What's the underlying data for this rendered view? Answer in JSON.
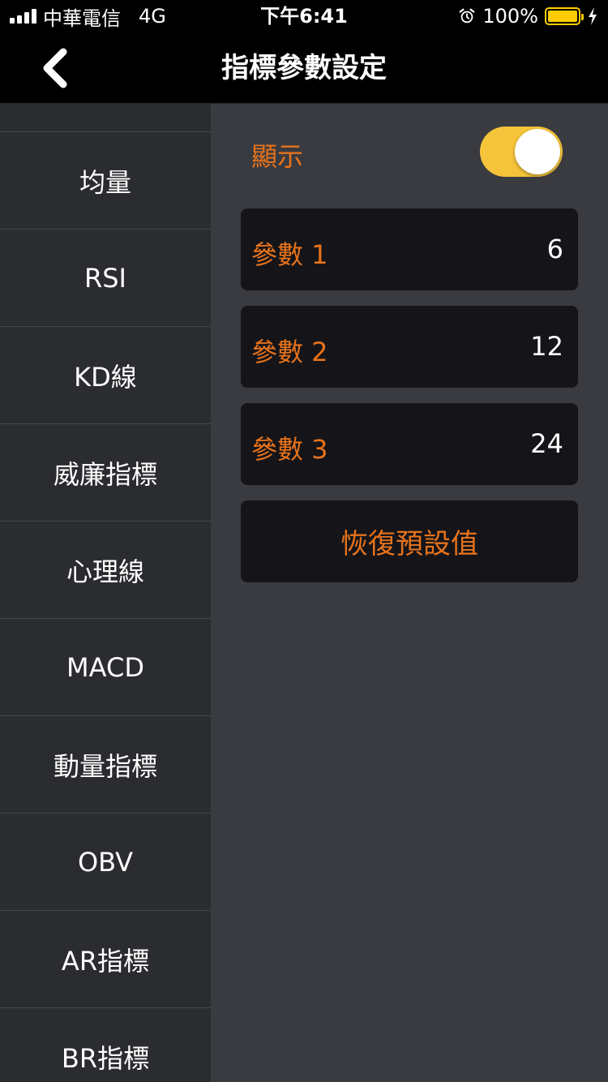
{
  "status_bar": {
    "carrier": "中華電信",
    "network": "4G",
    "time": "下午6:41",
    "battery_percent": "100%",
    "battery_level": 1.0,
    "battery_color": "#ffcc00"
  },
  "nav": {
    "title": "指標參數設定",
    "back_icon": "chevron-left-icon"
  },
  "sidebar": {
    "items": [
      {
        "label": "均量"
      },
      {
        "label": "RSI"
      },
      {
        "label": "KD線"
      },
      {
        "label": "威廉指標"
      },
      {
        "label": "心理線"
      },
      {
        "label": "MACD"
      },
      {
        "label": "動量指標"
      },
      {
        "label": "OBV"
      },
      {
        "label": "AR指標"
      },
      {
        "label": "BR指標"
      }
    ]
  },
  "panel": {
    "display_label": "顯示",
    "display_on": true,
    "toggle_color": "#f5c43a",
    "params": [
      {
        "label": "參數 1",
        "value": "6"
      },
      {
        "label": "參數 2",
        "value": "12"
      },
      {
        "label": "參數 3",
        "value": "24"
      }
    ],
    "reset_label": "恢復預設值",
    "accent_color": "#e8731a"
  }
}
